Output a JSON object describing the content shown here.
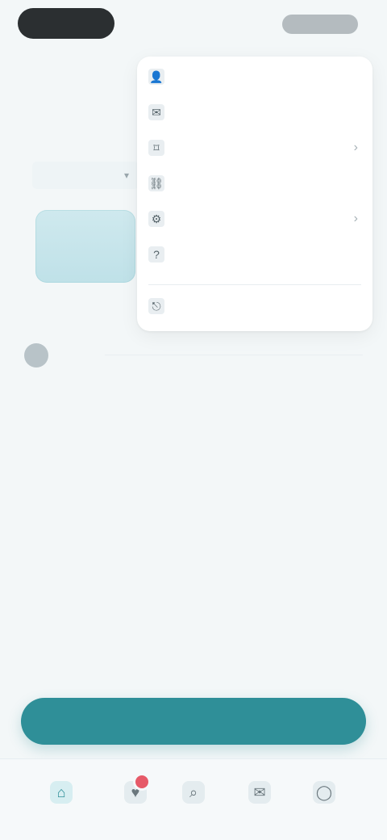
{
  "colors": {
    "background": "#f3f7f8",
    "accent": "#2f8f98",
    "badge": "#e65a68"
  },
  "header": {
    "pill_label": "",
    "right_label": ""
  },
  "left": {
    "title": "",
    "field_value": ""
  },
  "dropdown": {
    "items": [
      {
        "label": "",
        "icon": "user-icon",
        "has_chevron": false
      },
      {
        "label": "",
        "icon": "mail-icon",
        "has_chevron": false
      },
      {
        "label": "",
        "icon": "bookmark-icon",
        "has_chevron": true
      },
      {
        "label": "",
        "icon": "link-icon",
        "has_chevron": false
      },
      {
        "label": "",
        "icon": "settings-icon",
        "has_chevron": true
      },
      {
        "label": "",
        "icon": "help-icon",
        "has_chevron": false
      },
      {
        "label": "",
        "icon": "logout-icon",
        "has_chevron": false
      }
    ]
  },
  "info_row": {
    "text": ""
  },
  "small_tag": {
    "text": ""
  },
  "cta": {
    "label": ""
  },
  "bottom_nav": {
    "items": [
      {
        "label": "",
        "icon": "home-icon",
        "active": true
      },
      {
        "label": "",
        "icon": "heart-icon",
        "active": false,
        "badge": true
      },
      {
        "label": "",
        "icon": "search-icon",
        "active": false
      },
      {
        "label": "",
        "icon": "chat-icon",
        "active": false
      },
      {
        "label": "",
        "icon": "profile-icon",
        "active": false
      }
    ]
  }
}
